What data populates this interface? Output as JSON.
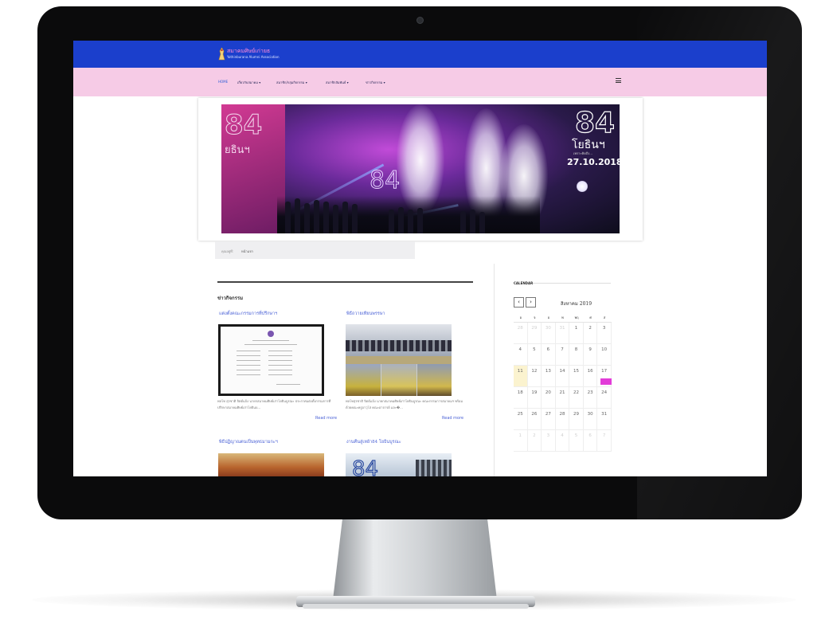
{
  "site": {
    "logo_title": "สมาคมศิษย์เก่ายธ",
    "logo_subtitle": "Yothinburana Alumni Association"
  },
  "nav": {
    "items": [
      {
        "label": "HOME"
      },
      {
        "label": "เกี่ยวกับสมาคม ▾"
      },
      {
        "label": "สมาชิก/กลุ่มกิจกรรม ▾"
      },
      {
        "label": "สมาชิกสัมพันธ์ ▾"
      },
      {
        "label": "ข่าวกิจกรรม ▾"
      }
    ],
    "menu_icon": "hamburger-icon"
  },
  "banner": {
    "left_mark": "84",
    "left_name": "ยธินฯ",
    "center_mark": "84",
    "right_mark": "84",
    "right_name": "โยธินฯ",
    "right_sub": "เพราะคิดถึง...",
    "date": "27.10.2018"
  },
  "breadcrumb": {
    "label": "คุณอยู่ที่:",
    "current": "หน้าแรก"
  },
  "news": {
    "section_title": "ข่าวกิจกรรม",
    "posts": [
      {
        "title": "แต่งตั้งคณะกรรมการที่ปรึกษาฯ",
        "excerpt": "พลโท สุรชาติ จิตต์แจ้ง นายกสมาคมศิษย์เก่าโยธินบูรณะ ประกาศแต่งตั้งกรรมการที่ปรึกษาสมาคมศิษย์เก่าโยธินบ...",
        "read_more": "Read more"
      },
      {
        "title": "พิธีถวายเทียนพรรษา",
        "excerpt": "พลโทสุรชาติ จิตต์แจ้ง นายกสมาคมศิษย์เก่าโยธินบูรณะ คณะกรรมการสมาคมฯ พร้อมด้วยคณะครูอาวุโส คณะอาจารย์ และ�...",
        "read_more": "Read more"
      },
      {
        "title": "พิธีปฏิญาณตนเป็นพุทธมามกะฯ"
      },
      {
        "title": "งานคืนสู่เหย้า84 โยธินบูรณะ"
      }
    ]
  },
  "calendar": {
    "heading": "CALENDAR",
    "month_label": "สิงหาคม 2019",
    "prev_label": "‹",
    "next_label": "›",
    "day_names": [
      "อ",
      "จ",
      "อ",
      "พ",
      "พฤ",
      "ศ",
      "ส"
    ],
    "weeks": [
      [
        "28",
        "29",
        "30",
        "31",
        "1",
        "2",
        "3"
      ],
      [
        "4",
        "5",
        "6",
        "7",
        "8",
        "9",
        "10"
      ],
      [
        "11",
        "12",
        "13",
        "14",
        "15",
        "16",
        "17"
      ],
      [
        "18",
        "19",
        "20",
        "21",
        "22",
        "23",
        "24"
      ],
      [
        "25",
        "26",
        "27",
        "28",
        "29",
        "30",
        "31"
      ],
      [
        "1",
        "2",
        "3",
        "4",
        "5",
        "6",
        "7"
      ]
    ],
    "highlight_color": "#e23cd8",
    "today_color": "#fbf3cf"
  },
  "colors": {
    "topbar": "#1b3fcc",
    "navbar": "#f6cbe6",
    "link": "#4b62d6"
  }
}
